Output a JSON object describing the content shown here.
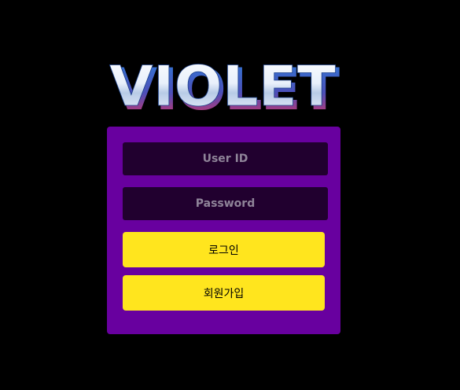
{
  "logo": {
    "text": "VIOLET"
  },
  "login_form": {
    "user_id_placeholder": "User ID",
    "password_placeholder": "Password",
    "login_label": "로그인",
    "signup_label": "회원가입"
  },
  "colors": {
    "background": "#000000",
    "panel": "#68009f",
    "field": "#21002f",
    "button": "#ffe51e"
  }
}
